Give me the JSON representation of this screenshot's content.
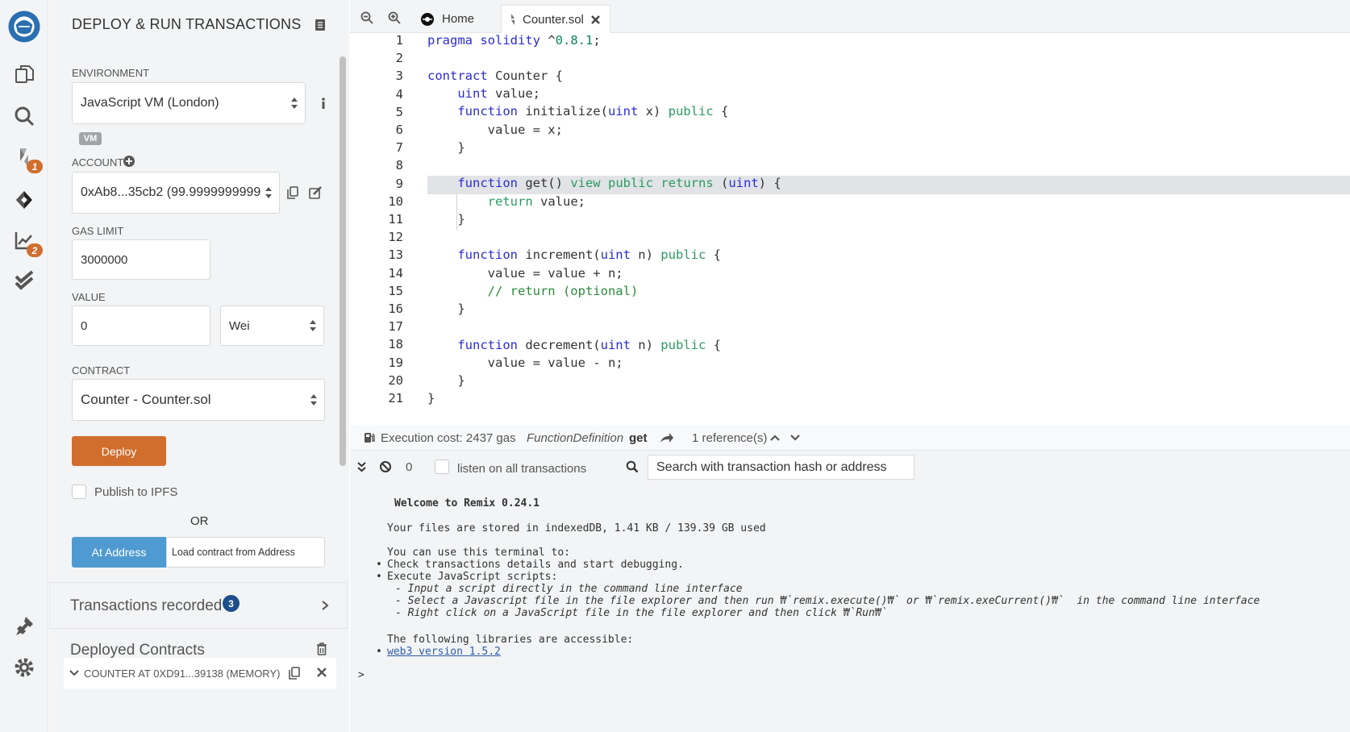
{
  "side_panel": {
    "title": "DEPLOY & RUN TRANSACTIONS",
    "environment_label": "ENVIRONMENT",
    "environment_value": "JavaScript VM (London)",
    "vm_badge": "VM",
    "account_label": "ACCOUNT",
    "account_value": "0xAb8...35cb2 (99.9999999999",
    "gas_limit_label": "GAS LIMIT",
    "gas_limit_value": "3000000",
    "value_label": "VALUE",
    "value_value": "0",
    "value_unit": "Wei",
    "contract_label": "CONTRACT",
    "contract_value": "Counter - Counter.sol",
    "deploy_label": "Deploy",
    "publish_label": "Publish to IPFS",
    "or_label": "OR",
    "at_address_label": "At Address",
    "load_contract_placeholder": "Load contract from Address",
    "transactions_recorded_label": "Transactions recorded",
    "transactions_recorded_count": "3",
    "deployed_contracts_label": "Deployed Contracts",
    "deployed_instance_label": "COUNTER AT 0XD91...39138 (MEMORY)"
  },
  "icon_badges": {
    "file_compiler": "1",
    "analysis": "2"
  },
  "tabs": [
    {
      "label": "Home"
    },
    {
      "label": "Counter.sol"
    }
  ],
  "editor": {
    "line_numbers": [
      "1",
      "2",
      "3",
      "4",
      "5",
      "6",
      "7",
      "8",
      "9",
      "10",
      "11",
      "12",
      "13",
      "14",
      "15",
      "16",
      "17",
      "18",
      "19",
      "20",
      "21"
    ]
  },
  "status": {
    "execution_cost": "Execution cost: 2437 gas",
    "function_def": "FunctionDefinition",
    "function_name": "get",
    "references": "1 reference(s)"
  },
  "terminal_bar": {
    "count": "0",
    "listen_label": "listen on all transactions",
    "search_placeholder": "Search with transaction hash or address"
  },
  "terminal": {
    "welcome": "Welcome to Remix 0.24.1",
    "storage": "Your files are stored in indexedDB, 1.41 KB / 139.39 GB used",
    "can_use": "You can use this terminal to:",
    "b1": "Check transactions details and start debugging.",
    "b2": "Execute JavaScript scripts:",
    "s1": "- Input a script directly in the command line interface",
    "s2": "- Select a Javascript file in the file explorer and then run ₩`remix.execute()₩` or ₩`remix.exeCurrent()₩`  in the command line interface",
    "s3": "- Right click on a JavaScript file in the file explorer and then click ₩`Run₩`",
    "libs": "The following libraries are accessible:",
    "lib1": "web3 version 1.5.2",
    "prompt": ">"
  },
  "colors": {
    "accent_orange": "#d16e2e",
    "accent_blue": "#4f9bd1",
    "remix_blue": "#2a6fb0"
  }
}
